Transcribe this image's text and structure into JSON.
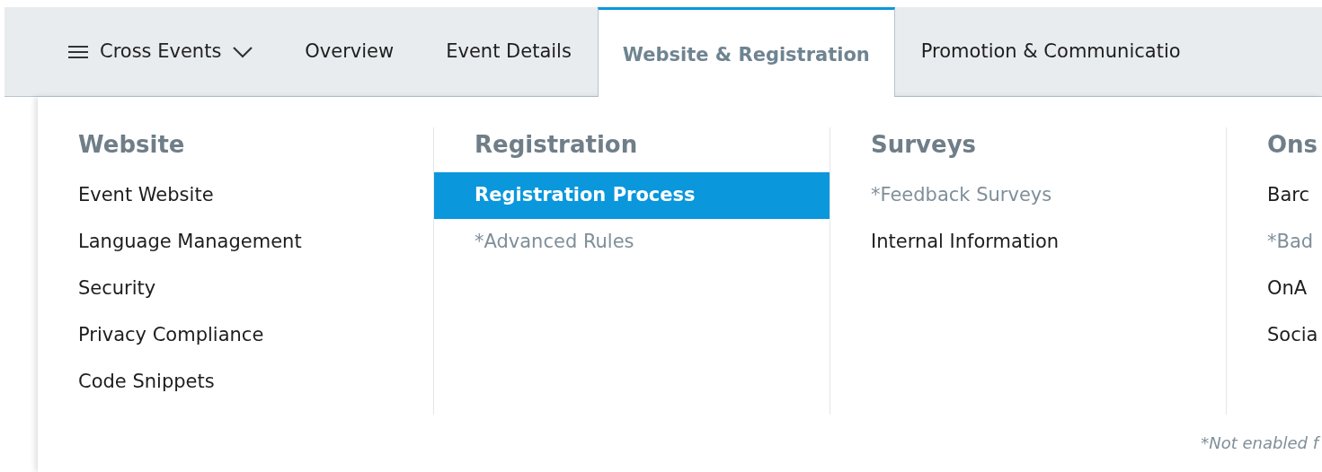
{
  "nav": {
    "menu": {
      "label": "Cross Events"
    },
    "tabs": [
      {
        "label": "Overview",
        "selected": false
      },
      {
        "label": "Event Details",
        "selected": false
      },
      {
        "label": "Website & Registration",
        "selected": true
      },
      {
        "label": "Promotion & Communicatio",
        "selected": false
      }
    ]
  },
  "mega_menu": {
    "columns": [
      {
        "heading": "Website",
        "items": [
          {
            "label": "Event Website",
            "disabled": false,
            "selected": false
          },
          {
            "label": "Language Management",
            "disabled": false,
            "selected": false
          },
          {
            "label": "Security",
            "disabled": false,
            "selected": false
          },
          {
            "label": "Privacy Compliance",
            "disabled": false,
            "selected": false
          },
          {
            "label": "Code Snippets",
            "disabled": false,
            "selected": false
          }
        ]
      },
      {
        "heading": "Registration",
        "items": [
          {
            "label": "Registration Process",
            "disabled": false,
            "selected": true
          },
          {
            "label": "*Advanced Rules",
            "disabled": true,
            "selected": false
          }
        ]
      },
      {
        "heading": "Surveys",
        "items": [
          {
            "label": "*Feedback Surveys",
            "disabled": true,
            "selected": false
          },
          {
            "label": "Internal Information",
            "disabled": false,
            "selected": false
          }
        ]
      },
      {
        "heading": "Ons",
        "items": [
          {
            "label": "Barc",
            "disabled": false,
            "selected": false
          },
          {
            "label": "*Bad",
            "disabled": true,
            "selected": false
          },
          {
            "label": "OnA",
            "disabled": false,
            "selected": false
          },
          {
            "label": "Socia",
            "disabled": false,
            "selected": false
          }
        ]
      }
    ],
    "footnote": "*Not enabled f"
  }
}
